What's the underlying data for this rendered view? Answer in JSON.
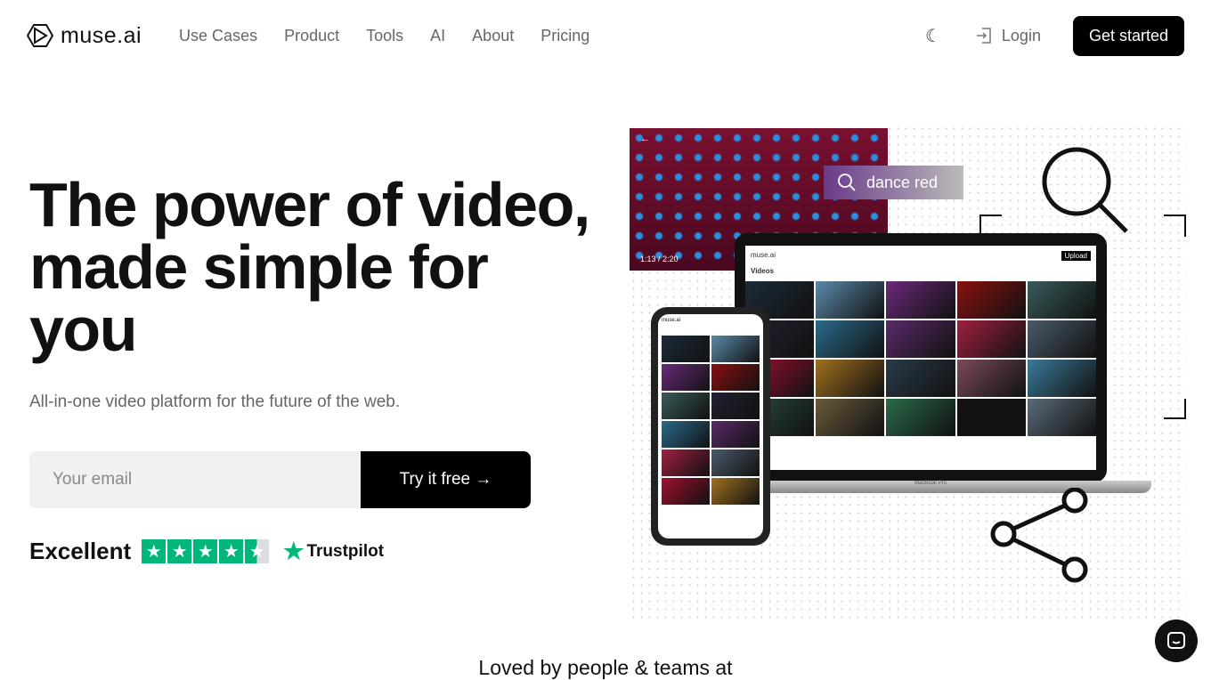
{
  "brand": "muse.ai",
  "nav": {
    "links": [
      "Use Cases",
      "Product",
      "Tools",
      "AI",
      "About",
      "Pricing"
    ],
    "login": "Login",
    "get_started": "Get started"
  },
  "hero": {
    "title": "The power of video, made simple for you",
    "subtitle": "All-in-one video platform for the future of the web.",
    "email_placeholder": "Your email",
    "try_button": "Try it free",
    "rating_label": "Excellent",
    "rating_stars": 4.5,
    "trustpilot": "Trustpilot"
  },
  "illustration": {
    "search_query": "dance red",
    "player_time": "1:13 / 2:20",
    "app_brand": "muse.ai",
    "app_upload": "Upload",
    "app_section": "Videos",
    "laptop_model": "MacBook Pro"
  },
  "loved": "Loved by people & teams at",
  "colors": {
    "accent": "#000000",
    "trustpilot": "#00b67a"
  }
}
